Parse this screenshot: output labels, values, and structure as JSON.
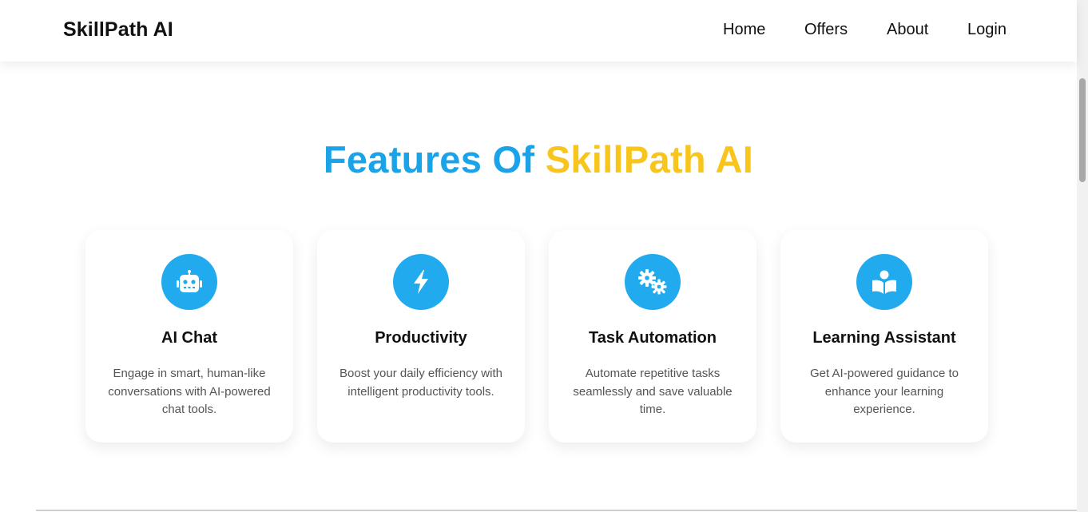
{
  "navbar": {
    "brand": "SkillPath AI",
    "links": [
      "Home",
      "Offers",
      "About",
      "Login"
    ]
  },
  "features": {
    "title_part1": "Features Of",
    "title_part2": "SkillPath AI",
    "cards": [
      {
        "icon": "robot-icon",
        "title": "AI Chat",
        "description": "Engage in smart, human-like conversations with AI-powered chat tools."
      },
      {
        "icon": "lightning-bolt-icon",
        "title": "Productivity",
        "description": "Boost your daily efficiency with intelligent productivity tools."
      },
      {
        "icon": "gears-icon",
        "title": "Task Automation",
        "description": "Automate repetitive tasks seamlessly and save valuable time."
      },
      {
        "icon": "book-reader-icon",
        "title": "Learning Assistant",
        "description": "Get AI-powered guidance to enhance your learning experience."
      }
    ]
  },
  "colors": {
    "accent_blue": "#1aa3e8",
    "accent_yellow": "#f8c51d",
    "icon_bg": "#22aaee"
  }
}
